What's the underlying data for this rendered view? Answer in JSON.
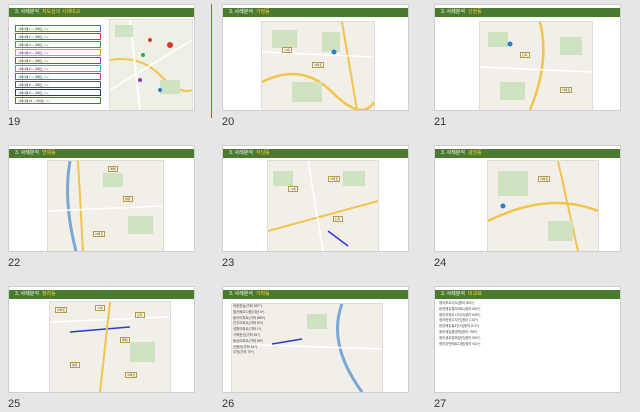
{
  "slides": [
    {
      "number": "19",
      "header": "3. 사례분석",
      "subtitle": "지도상의 사례비교",
      "legend_items": [
        "거래사례 1 ― 아파트 ○○○",
        "거래사례 2 ― 아파트 ○○○",
        "거래사례 3 ― 아파트 ○○○",
        "거래사례 4 ― 아파트 ○○○",
        "거래사례 5 ― 아파트 ○○○",
        "거래사례 6 ― 아파트 ○○○",
        "거래사례 7 ― 아파트 ○○○",
        "거래사례 8 ― 아파트 ○○○",
        "거래사례 9 ― 아파트 ○○○",
        "거래사례 10 ― 아파트 ○○○"
      ]
    },
    {
      "number": "20",
      "header": "3. 사례분석",
      "subtitle": "가정동"
    },
    {
      "number": "21",
      "header": "3. 사례분석",
      "subtitle": "신현동"
    },
    {
      "number": "22",
      "header": "3. 사례분석",
      "subtitle": "연희동"
    },
    {
      "number": "23",
      "header": "3. 사례분석",
      "subtitle": "석남동"
    },
    {
      "number": "24",
      "header": "3. 사례분석",
      "subtitle": "검암동"
    },
    {
      "number": "25",
      "header": "3. 사례분석",
      "subtitle": "청라동"
    },
    {
      "number": "26",
      "header": "3. 사례분석",
      "subtitle": "가좌동"
    },
    {
      "number": "27",
      "header": "3. 사례분석",
      "subtitle": "비교표",
      "list_items": [
        "청라푸르지오(청라 892*)",
        "한양에듀힐아파트(청라 883*)",
        "청라국제도시자이(청라 845*)",
        "청라한양수자인(청라 C32*)",
        "한양에듀힐1단지(청라 872*)",
        "청라제일풍경채(청라 755*)",
        "청라센트럴에일린(청라 552*)",
        "청라호반베르디움(청라 931*)"
      ]
    }
  ],
  "slide26_list": [
    "대림한숲(가좌 987*)",
    "월산베르디움(석남 6*)",
    "동아아파트(가좌 889*)",
    "진주아파트(가좌 83*)",
    "성원아파트(가좌 1*)",
    "가좌한신(가좌 81*)",
    "동남아파트(가좌 58*)",
    "신동아(가좌 54*)",
    "우방(가좌 79*)"
  ],
  "map_labels": [
    "아파트",
    "시세",
    "단지",
    "매매",
    "평형"
  ],
  "colors": {
    "header": "#4a7a2e",
    "subtitle": "#ffd23a",
    "background": "#e6e6e6"
  }
}
